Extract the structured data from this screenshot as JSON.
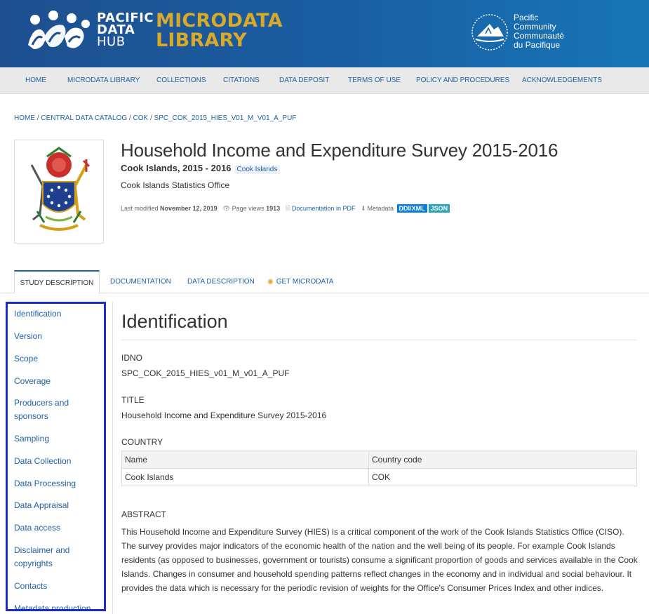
{
  "header": {
    "pdh_line1": "PACIFIC",
    "pdh_line2": "DATA",
    "pdh_line3": "HUB",
    "mdl_line1": "MICRODATA",
    "mdl_line2": "LIBRARY",
    "spc_line1": "Pacific",
    "spc_line2": "Community",
    "spc_line3": "Communauté",
    "spc_line4": "du Pacifique",
    "colors": {
      "bg_start": "#1d4f8f",
      "bg_end": "#1776b7",
      "gold": "#d8aa2b"
    }
  },
  "nav": {
    "items": [
      {
        "label": "HOME"
      },
      {
        "label": "MICRODATA LIBRARY"
      },
      {
        "label": "COLLECTIONS"
      },
      {
        "label": "CITATIONS"
      },
      {
        "label": "DATA DEPOSIT"
      },
      {
        "label": "TERMS OF USE"
      },
      {
        "label": "POLICY AND PROCEDURES"
      },
      {
        "label": "ACKNOWLEDGEMENTS"
      }
    ]
  },
  "breadcrumb": {
    "home": "HOME",
    "catalog": "CENTRAL DATA CATALOG",
    "country": "COK",
    "study": "SPC_COK_2015_HIES_V01_M_V01_A_PUF",
    "separator": " / "
  },
  "study": {
    "title": "Household Income and Expenditure Survey 2015-2016",
    "subtitle": "Cook Islands, 2015 - 2016",
    "tag": "Cook Islands",
    "agency": "Cook Islands Statistics Office",
    "last_modified_label": "Last modified",
    "last_modified": "November 12, 2019",
    "page_views_label": "Page views",
    "page_views": "1913",
    "doc_pdf": "Documentation in PDF",
    "metadata_label": "Metadata",
    "ddi_badge": "DDI/XML",
    "json_badge": "JSON"
  },
  "tabs": [
    {
      "label": "STUDY DESCRIPTION"
    },
    {
      "label": "DOCUMENTATION"
    },
    {
      "label": "DATA DESCRIPTION"
    },
    {
      "label": "GET MICRODATA"
    }
  ],
  "sidebar": {
    "items": [
      {
        "label": "Identification"
      },
      {
        "label": "Version"
      },
      {
        "label": "Scope"
      },
      {
        "label": "Coverage"
      },
      {
        "label": "Producers and sponsors"
      },
      {
        "label": "Sampling"
      },
      {
        "label": "Data Collection"
      },
      {
        "label": "Data Processing"
      },
      {
        "label": "Data Appraisal"
      },
      {
        "label": "Data access"
      },
      {
        "label": "Disclaimer and copyrights"
      },
      {
        "label": "Contacts"
      },
      {
        "label": "Metadata production"
      }
    ]
  },
  "content": {
    "heading": "Identification",
    "idno_label": "IDNO",
    "idno_value": "SPC_COK_2015_HIES_v01_M_v01_A_PUF",
    "title_label": "TITLE",
    "title_value": "Household Income and Expenditure Survey 2015-2016",
    "country_label": "COUNTRY",
    "country_table": {
      "headers": [
        "Name",
        "Country code"
      ],
      "rows": [
        [
          "Cook Islands",
          "COK"
        ]
      ]
    },
    "abstract_label": "ABSTRACT",
    "abstract_text": "This Household Income and Expenditure Survey (HIES) is a critical component of the work of the Cook Islands Statistics Office (CISO). The survey provides major indicators of the economic health of the nation and the well being of its people. For example Cook Islands residents (as opposed to businesses, government or tourists) consume a significant proportion of goods and services available in the Cook Islands. Changes in consumer and household spending patterns reflect changes in the economy and in individual and social behaviour. It provides the data which is necessary for the periodic revision of weights for the Office's Consumer Prices Index and other indices."
  }
}
